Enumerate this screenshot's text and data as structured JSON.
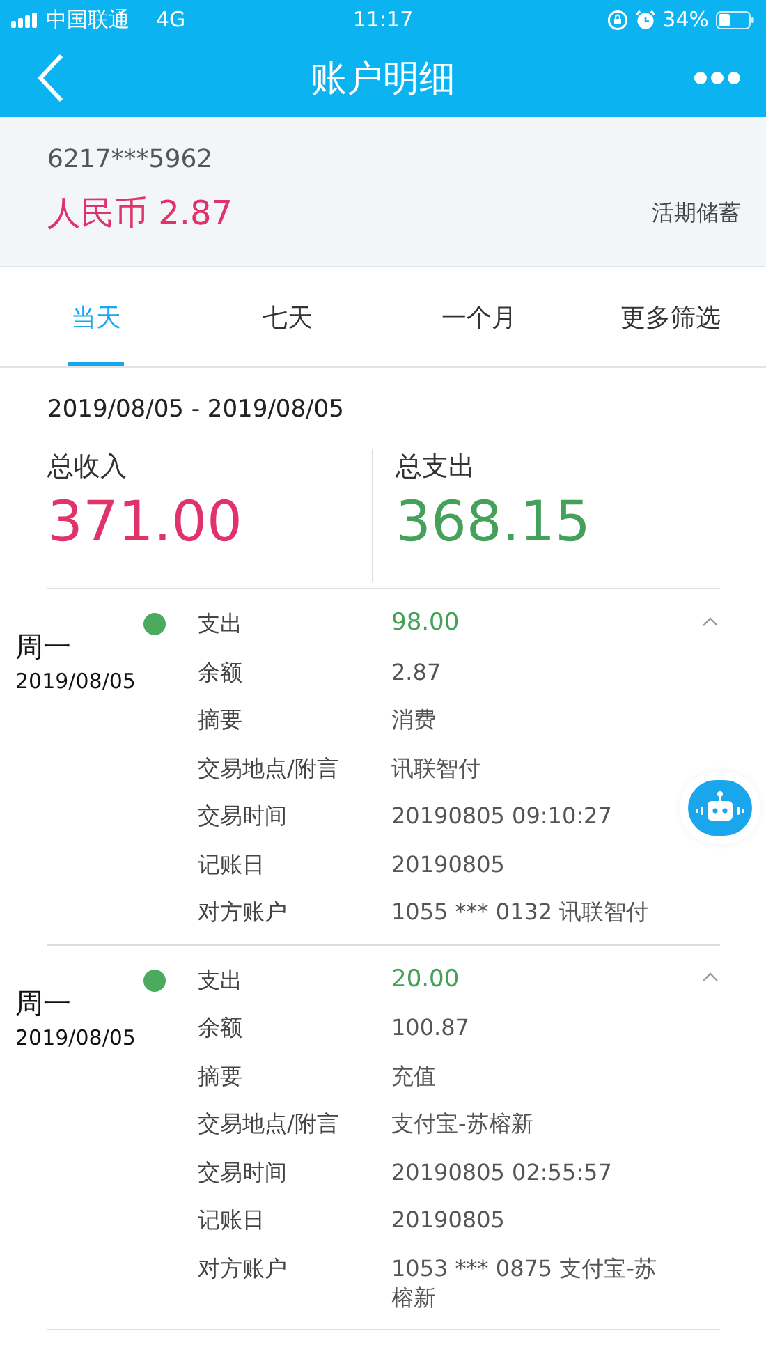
{
  "status_bar": {
    "carrier": "中国联通",
    "network": "4G",
    "time": "11:17",
    "battery_text": "34%"
  },
  "nav": {
    "title": "账户明细"
  },
  "account": {
    "number": "6217***5962",
    "balance": "人民币 2.87",
    "type": "活期储蓄"
  },
  "tabs": [
    {
      "label": "当天",
      "selected": true
    },
    {
      "label": "七天",
      "selected": false
    },
    {
      "label": "一个月",
      "selected": false
    },
    {
      "label": "更多筛选",
      "selected": false
    }
  ],
  "date_range": "2019/08/05 - 2019/08/05",
  "summary": [
    {
      "kind": "income",
      "label": "总收入",
      "amount": "371.00"
    },
    {
      "kind": "expense",
      "label": "总支出",
      "amount": "368.15"
    }
  ],
  "transactions": [
    {
      "weekday": "周一",
      "date": "2019/08/05",
      "color": "#4caa5e",
      "expanded": true,
      "fields": [
        {
          "kind": "amount",
          "label": "支出",
          "value": "98.00"
        },
        {
          "kind": "text",
          "label": "余额",
          "value": "2.87"
        },
        {
          "kind": "text",
          "label": "摘要",
          "value": "消费"
        },
        {
          "kind": "text",
          "label": "交易地点/附言",
          "value": "讯联智付"
        },
        {
          "kind": "text",
          "label": "交易时间",
          "value": "20190805 09:10:27"
        },
        {
          "kind": "text",
          "label": "记账日",
          "value": "20190805"
        },
        {
          "kind": "text",
          "label": "对方账户",
          "value": "1055 *** 0132 讯联智付"
        }
      ]
    },
    {
      "weekday": "周一",
      "date": "2019/08/05",
      "color": "#4caa5e",
      "expanded": true,
      "fields": [
        {
          "kind": "amount",
          "label": "支出",
          "value": "20.00"
        },
        {
          "kind": "text",
          "label": "余额",
          "value": "100.87"
        },
        {
          "kind": "text",
          "label": "摘要",
          "value": "充值"
        },
        {
          "kind": "text",
          "label": "交易地点/附言",
          "value": "支付宝-苏榕新"
        },
        {
          "kind": "text",
          "label": "交易时间",
          "value": "20190805 02:55:57"
        },
        {
          "kind": "text",
          "label": "记账日",
          "value": "20190805"
        },
        {
          "kind": "text",
          "label": "对方账户",
          "value": "1053 *** 0875 支付宝-苏榕新"
        }
      ]
    }
  ]
}
